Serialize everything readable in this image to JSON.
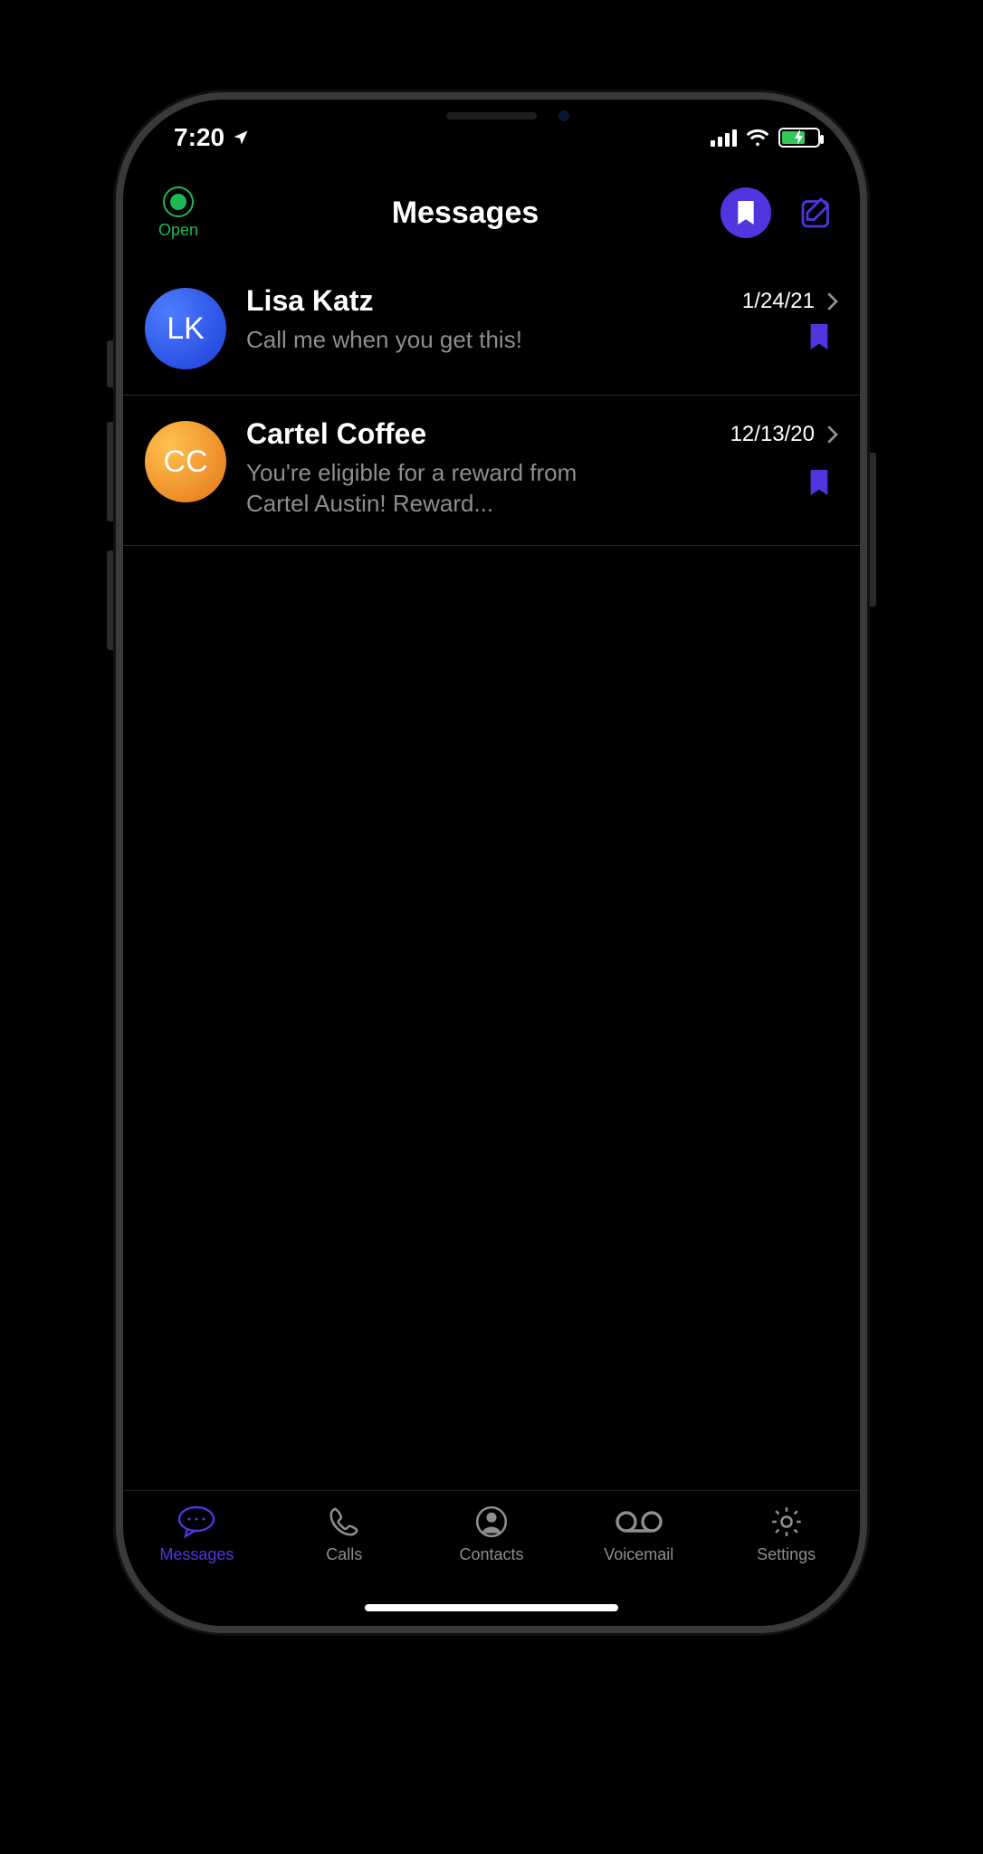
{
  "statusbar": {
    "time": "7:20",
    "location_icon": "location-arrow-icon",
    "cell_bars": 4,
    "wifi": true,
    "battery_charging": true
  },
  "header": {
    "status_label": "Open",
    "status_color": "#1db954",
    "title": "Messages",
    "bookmark_filter": true,
    "compose": true
  },
  "messages": [
    {
      "initials": "LK",
      "avatar_color": "blue",
      "name": "Lisa Katz",
      "date": "1/24/21",
      "snippet": "Call me when you get this!",
      "bookmarked": true
    },
    {
      "initials": "CC",
      "avatar_color": "orange",
      "name": "Cartel Coffee",
      "date": "12/13/20",
      "snippet": "You're eligible for a reward from Cartel Austin! Reward...",
      "bookmarked": true
    }
  ],
  "tabs": [
    {
      "id": "messages",
      "label": "Messages",
      "active": true
    },
    {
      "id": "calls",
      "label": "Calls",
      "active": false
    },
    {
      "id": "contacts",
      "label": "Contacts",
      "active": false
    },
    {
      "id": "voicemail",
      "label": "Voicemail",
      "active": false
    },
    {
      "id": "settings",
      "label": "Settings",
      "active": false
    }
  ],
  "accent": "#5136e0"
}
